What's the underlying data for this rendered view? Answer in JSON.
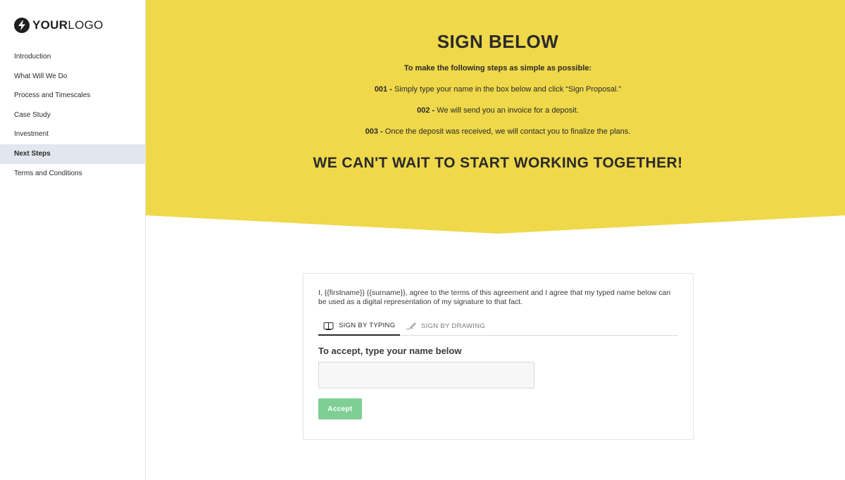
{
  "brand": {
    "logo_bold": "YOUR",
    "logo_light": "LOGO",
    "accent_color": "#efd84a",
    "button_color": "#7fcf95"
  },
  "sidebar": {
    "items": [
      {
        "label": "Introduction",
        "active": false
      },
      {
        "label": "What Will We Do",
        "active": false
      },
      {
        "label": "Process and Timescales",
        "active": false
      },
      {
        "label": "Case Study",
        "active": false
      },
      {
        "label": "Investment",
        "active": false
      },
      {
        "label": "Next Steps",
        "active": true
      },
      {
        "label": "Terms and Conditions",
        "active": false
      }
    ]
  },
  "hero": {
    "title": "SIGN BELOW",
    "intro": "To make the following steps as simple as possible:",
    "steps": [
      {
        "number": "001 -",
        "text": " Simply type your name in the box below and click “Sign Proposal.”"
      },
      {
        "number": "002 -",
        "text": " We will send you an invoice for a deposit."
      },
      {
        "number": "003 -",
        "text": " Once the deposit was received, we will contact you to finalize the plans."
      }
    ],
    "tagline": "WE CAN'T WAIT TO START WORKING TOGETHER!"
  },
  "signature": {
    "agreement_text": "I, {{firstname}} {{surname}}, agree to the terms of this agreement and I agree that my typed name below can be used as a digital representation of my signature to that fact.",
    "tabs": [
      {
        "label": "SIGN BY TYPING",
        "icon": "keyboard-icon",
        "active": true
      },
      {
        "label": "SIGN BY DRAWING",
        "icon": "pen-icon",
        "active": false
      }
    ],
    "accept_label": "To accept, type your name below",
    "name_value": "",
    "accept_button": "Accept"
  }
}
